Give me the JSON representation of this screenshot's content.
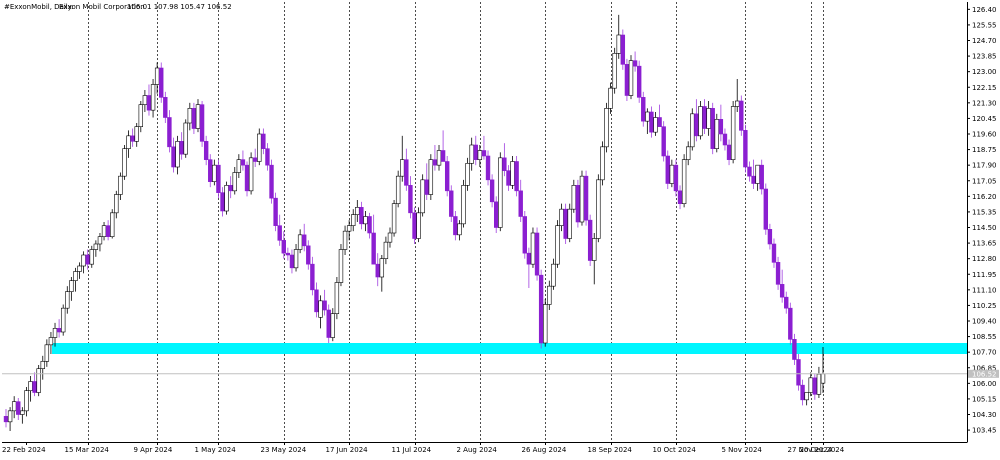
{
  "header": {
    "symbol": "#ExxonMobil, Daily:",
    "name": "Exxon Mobil Corporation",
    "ohlc": "106.01 107.98 105.47 106.52"
  },
  "colors": {
    "bull": "#ffffff",
    "bear": "#8b1fd1",
    "bear_wick": "#a040e0",
    "outline": "#000000",
    "zone": "#00f6ff",
    "grid": "#000000",
    "price_line": "#c0c0c0"
  },
  "chart_data": {
    "type": "candlestick",
    "title": "#ExxonMobil, Daily:",
    "ylim": [
      102.8,
      126.8
    ],
    "y_ticks": [
      "126.40",
      "125.55",
      "124.70",
      "123.85",
      "123.00",
      "122.15",
      "121.30",
      "120.45",
      "119.60",
      "118.75",
      "117.90",
      "117.05",
      "116.20",
      "115.35",
      "114.50",
      "113.65",
      "112.80",
      "111.95",
      "111.10",
      "110.25",
      "109.40",
      "108.55",
      "107.70",
      "106.85",
      "106.00",
      "105.15",
      "104.30",
      "103.45"
    ],
    "x_labels": [
      "22 Feb 2024",
      "15 Mar 2024",
      "9 Apr 2024",
      "1 May 2024",
      "23 May 2024",
      "17 Jun 2024",
      "11 Jul 2024",
      "2 Aug 2024",
      "26 Aug 2024",
      "18 Sep 2024",
      "10 Oct 2024",
      "5 Nov 2024",
      "27 Nov 2024",
      "20 Dec 2024"
    ],
    "current_price": "106.52",
    "support_zone": {
      "low": 107.6,
      "high": 108.2
    },
    "candles": [
      [
        104.2,
        104.6,
        103.6,
        103.9
      ],
      [
        103.9,
        104.7,
        103.4,
        104.5
      ],
      [
        104.5,
        105.3,
        104.1,
        105.0
      ],
      [
        105.0,
        105.2,
        104.0,
        104.3
      ],
      [
        104.3,
        104.7,
        103.8,
        104.5
      ],
      [
        104.5,
        105.8,
        104.2,
        105.6
      ],
      [
        105.6,
        106.4,
        105.0,
        106.1
      ],
      [
        106.1,
        106.6,
        105.3,
        105.5
      ],
      [
        105.5,
        107.0,
        105.3,
        106.8
      ],
      [
        106.8,
        107.5,
        106.2,
        107.2
      ],
      [
        107.2,
        108.4,
        106.9,
        108.1
      ],
      [
        108.1,
        108.8,
        107.6,
        108.5
      ],
      [
        108.5,
        109.3,
        108.0,
        109.0
      ],
      [
        109.0,
        109.5,
        108.5,
        108.8
      ],
      [
        108.8,
        110.3,
        108.6,
        110.1
      ],
      [
        110.1,
        111.3,
        109.8,
        111.0
      ],
      [
        111.0,
        111.8,
        110.5,
        111.6
      ],
      [
        111.6,
        112.3,
        111.0,
        112.1
      ],
      [
        112.1,
        112.6,
        111.7,
        112.4
      ],
      [
        112.4,
        113.2,
        112.0,
        113.0
      ],
      [
        113.0,
        113.3,
        112.2,
        112.5
      ],
      [
        112.5,
        113.5,
        112.3,
        113.3
      ],
      [
        113.3,
        113.8,
        112.9,
        113.6
      ],
      [
        113.6,
        114.2,
        113.2,
        114.0
      ],
      [
        114.0,
        114.8,
        113.8,
        114.6
      ],
      [
        114.6,
        114.9,
        113.8,
        114.0
      ],
      [
        114.0,
        115.5,
        113.9,
        115.3
      ],
      [
        115.3,
        116.5,
        115.0,
        116.3
      ],
      [
        116.3,
        117.5,
        116.0,
        117.3
      ],
      [
        117.3,
        119.0,
        117.1,
        118.8
      ],
      [
        118.8,
        119.8,
        118.3,
        119.5
      ],
      [
        119.5,
        119.9,
        118.9,
        119.2
      ],
      [
        119.2,
        120.2,
        118.9,
        120.0
      ],
      [
        120.0,
        121.4,
        119.7,
        121.2
      ],
      [
        121.2,
        122.0,
        120.8,
        121.7
      ],
      [
        121.7,
        122.3,
        120.6,
        120.9
      ],
      [
        120.9,
        122.6,
        120.5,
        122.3
      ],
      [
        122.3,
        123.5,
        121.8,
        123.2
      ],
      [
        123.2,
        123.5,
        121.3,
        121.6
      ],
      [
        121.6,
        121.9,
        120.2,
        120.5
      ],
      [
        120.5,
        120.9,
        118.6,
        118.9
      ],
      [
        118.9,
        119.4,
        117.5,
        117.8
      ],
      [
        117.8,
        119.5,
        117.4,
        119.2
      ],
      [
        119.2,
        119.7,
        118.2,
        118.5
      ],
      [
        118.5,
        120.4,
        118.3,
        120.2
      ],
      [
        120.2,
        121.3,
        119.8,
        121.0
      ],
      [
        121.0,
        121.3,
        119.6,
        119.9
      ],
      [
        119.9,
        121.5,
        119.7,
        121.2
      ],
      [
        121.2,
        121.4,
        118.9,
        119.2
      ],
      [
        119.2,
        119.5,
        117.9,
        118.2
      ],
      [
        118.2,
        118.5,
        116.7,
        117.0
      ],
      [
        117.0,
        118.2,
        116.8,
        117.9
      ],
      [
        117.9,
        118.2,
        116.1,
        116.4
      ],
      [
        116.4,
        116.7,
        115.1,
        115.4
      ],
      [
        115.4,
        117.0,
        115.2,
        116.8
      ],
      [
        116.8,
        117.3,
        116.1,
        116.5
      ],
      [
        116.5,
        117.8,
        116.3,
        117.5
      ],
      [
        117.5,
        118.5,
        117.2,
        118.2
      ],
      [
        118.2,
        118.7,
        117.6,
        117.9
      ],
      [
        117.9,
        118.1,
        116.2,
        116.5
      ],
      [
        116.5,
        118.6,
        116.3,
        118.3
      ],
      [
        118.3,
        118.8,
        117.8,
        118.1
      ],
      [
        118.1,
        119.9,
        117.9,
        119.6
      ],
      [
        119.6,
        119.9,
        118.5,
        118.8
      ],
      [
        118.8,
        119.1,
        117.6,
        117.9
      ],
      [
        117.9,
        118.2,
        115.8,
        116.1
      ],
      [
        116.1,
        116.4,
        114.3,
        114.6
      ],
      [
        114.6,
        115.2,
        113.5,
        113.8
      ],
      [
        113.8,
        114.3,
        112.8,
        113.1
      ],
      [
        113.1,
        113.4,
        112.7,
        113.0
      ],
      [
        113.0,
        113.3,
        112.0,
        112.3
      ],
      [
        112.3,
        113.6,
        112.1,
        113.3
      ],
      [
        113.3,
        114.4,
        113.1,
        114.1
      ],
      [
        114.1,
        114.7,
        113.2,
        113.5
      ],
      [
        113.5,
        113.8,
        112.2,
        112.5
      ],
      [
        112.5,
        112.9,
        110.8,
        111.1
      ],
      [
        111.1,
        111.5,
        109.6,
        109.9
      ],
      [
        109.6,
        110.8,
        109.0,
        110.5
      ],
      [
        110.5,
        111.1,
        109.7,
        110.0
      ],
      [
        110.0,
        110.3,
        108.2,
        108.5
      ],
      [
        108.5,
        110.1,
        108.3,
        109.8
      ],
      [
        109.8,
        111.8,
        109.5,
        111.5
      ],
      [
        111.5,
        113.6,
        111.3,
        113.3
      ],
      [
        113.3,
        114.6,
        113.0,
        114.3
      ],
      [
        114.3,
        114.9,
        113.8,
        114.6
      ],
      [
        114.6,
        115.5,
        114.3,
        115.2
      ],
      [
        115.2,
        116.0,
        114.8,
        115.6
      ],
      [
        115.6,
        115.9,
        114.4,
        114.7
      ],
      [
        114.7,
        115.4,
        114.3,
        115.1
      ],
      [
        115.1,
        115.3,
        113.9,
        114.2
      ],
      [
        114.2,
        115.2,
        112.8,
        112.5
      ],
      [
        112.5,
        113.1,
        111.3,
        111.8
      ],
      [
        111.8,
        113.0,
        111.0,
        112.8
      ],
      [
        112.8,
        114.0,
        112.5,
        113.7
      ],
      [
        113.7,
        114.5,
        113.4,
        114.2
      ],
      [
        114.2,
        116.0,
        114.0,
        115.8
      ],
      [
        115.8,
        117.6,
        115.6,
        117.3
      ],
      [
        117.3,
        119.5,
        117.0,
        118.2
      ],
      [
        118.2,
        118.8,
        116.5,
        116.8
      ],
      [
        116.8,
        117.3,
        115.0,
        115.3
      ],
      [
        115.3,
        115.6,
        113.6,
        113.9
      ],
      [
        113.9,
        115.6,
        113.7,
        115.3
      ],
      [
        115.3,
        117.4,
        115.1,
        117.1
      ],
      [
        117.1,
        118.0,
        116.0,
        116.3
      ],
      [
        116.3,
        118.5,
        116.0,
        118.2
      ],
      [
        118.2,
        119.0,
        117.6,
        117.9
      ],
      [
        117.9,
        119.0,
        117.6,
        118.7
      ],
      [
        118.7,
        119.8,
        118.4,
        118.1
      ],
      [
        118.1,
        118.4,
        116.2,
        116.5
      ],
      [
        116.5,
        116.8,
        114.8,
        115.1
      ],
      [
        115.1,
        115.4,
        113.8,
        114.1
      ],
      [
        114.1,
        114.9,
        113.8,
        114.7
      ],
      [
        114.7,
        117.1,
        114.5,
        116.8
      ],
      [
        116.8,
        118.3,
        116.5,
        118.0
      ],
      [
        118.0,
        119.4,
        117.6,
        119.0
      ],
      [
        119.0,
        119.5,
        117.9,
        118.2
      ],
      [
        118.2,
        119.0,
        117.8,
        118.7
      ],
      [
        118.7,
        119.5,
        118.2,
        118.4
      ],
      [
        118.4,
        118.7,
        116.8,
        117.1
      ],
      [
        117.1,
        117.4,
        115.6,
        115.9
      ],
      [
        115.9,
        116.2,
        114.2,
        114.5
      ],
      [
        114.5,
        118.6,
        114.3,
        118.3
      ],
      [
        118.3,
        119.1,
        117.3,
        117.6
      ],
      [
        117.6,
        117.9,
        116.5,
        116.8
      ],
      [
        116.8,
        118.4,
        116.6,
        118.1
      ],
      [
        118.1,
        118.4,
        116.2,
        116.5
      ],
      [
        116.5,
        117.1,
        114.8,
        115.1
      ],
      [
        115.1,
        115.4,
        112.8,
        113.1
      ],
      [
        113.1,
        113.4,
        111.2,
        112.5
      ],
      [
        112.5,
        114.5,
        112.3,
        114.2
      ],
      [
        114.2,
        114.5,
        111.6,
        111.9
      ],
      [
        111.9,
        112.2,
        107.9,
        108.2
      ],
      [
        108.2,
        110.6,
        108.0,
        110.3
      ],
      [
        110.3,
        111.6,
        110.0,
        111.3
      ],
      [
        111.3,
        112.8,
        111.1,
        112.5
      ],
      [
        112.5,
        114.9,
        112.3,
        114.6
      ],
      [
        114.6,
        115.8,
        114.3,
        115.5
      ],
      [
        115.5,
        115.8,
        113.6,
        113.9
      ],
      [
        113.9,
        115.8,
        113.7,
        115.5
      ],
      [
        115.5,
        117.1,
        115.3,
        116.8
      ],
      [
        116.8,
        117.1,
        114.5,
        114.8
      ],
      [
        114.8,
        117.6,
        114.6,
        117.3
      ],
      [
        117.3,
        117.6,
        114.6,
        114.9
      ],
      [
        114.9,
        115.2,
        112.4,
        112.7
      ],
      [
        112.7,
        114.2,
        111.4,
        113.9
      ],
      [
        113.9,
        117.4,
        113.7,
        117.1
      ],
      [
        117.1,
        119.2,
        116.8,
        118.9
      ],
      [
        118.9,
        121.3,
        118.6,
        121.0
      ],
      [
        121.0,
        122.4,
        120.7,
        122.1
      ],
      [
        122.1,
        124.3,
        121.8,
        124.0
      ],
      [
        124.0,
        126.1,
        123.7,
        125.0
      ],
      [
        125.0,
        125.3,
        123.1,
        123.4
      ],
      [
        123.4,
        123.7,
        121.4,
        121.7
      ],
      [
        121.7,
        123.9,
        121.5,
        123.6
      ],
      [
        123.6,
        124.1,
        123.0,
        123.3
      ],
      [
        123.3,
        123.6,
        121.3,
        121.6
      ],
      [
        121.6,
        121.9,
        120.0,
        120.3
      ],
      [
        120.3,
        121.0,
        119.6,
        120.8
      ],
      [
        120.8,
        121.1,
        119.4,
        119.7
      ],
      [
        119.7,
        120.8,
        119.5,
        120.5
      ],
      [
        120.5,
        121.2,
        120.2,
        120.0
      ],
      [
        120.0,
        120.3,
        118.1,
        118.4
      ],
      [
        118.4,
        118.7,
        116.6,
        116.9
      ],
      [
        116.9,
        118.2,
        116.7,
        117.9
      ],
      [
        117.9,
        118.2,
        116.2,
        116.5
      ],
      [
        116.5,
        116.8,
        115.5,
        115.8
      ],
      [
        115.8,
        118.5,
        115.6,
        118.2
      ],
      [
        118.2,
        119.2,
        117.9,
        118.9
      ],
      [
        118.9,
        121.0,
        118.7,
        120.7
      ],
      [
        120.7,
        121.5,
        119.2,
        119.5
      ],
      [
        119.5,
        121.4,
        119.3,
        121.1
      ],
      [
        121.1,
        121.5,
        119.6,
        119.9
      ],
      [
        119.9,
        121.4,
        119.5,
        121.0
      ],
      [
        121.0,
        121.3,
        118.5,
        118.8
      ],
      [
        118.8,
        120.7,
        118.6,
        120.4
      ],
      [
        120.4,
        121.2,
        119.2,
        119.6
      ],
      [
        119.6,
        119.9,
        118.7,
        119.0
      ],
      [
        119.0,
        119.3,
        117.9,
        118.2
      ],
      [
        118.2,
        121.4,
        118.0,
        121.1
      ],
      [
        121.1,
        122.6,
        120.8,
        121.4
      ],
      [
        121.4,
        121.7,
        119.5,
        119.8
      ],
      [
        119.8,
        120.1,
        117.5,
        117.8
      ],
      [
        117.8,
        118.1,
        117.0,
        117.3
      ],
      [
        117.3,
        118.2,
        116.6,
        116.9
      ],
      [
        116.9,
        117.2,
        116.5,
        117.9
      ],
      [
        117.9,
        118.2,
        116.3,
        116.6
      ],
      [
        116.6,
        116.9,
        114.1,
        114.4
      ],
      [
        114.4,
        114.7,
        113.3,
        113.6
      ],
      [
        113.6,
        113.9,
        112.3,
        112.6
      ],
      [
        112.6,
        112.9,
        111.1,
        111.4
      ],
      [
        111.4,
        112.2,
        110.4,
        110.7
      ],
      [
        110.7,
        111.0,
        109.8,
        110.1
      ],
      [
        110.1,
        110.4,
        108.1,
        108.4
      ],
      [
        108.4,
        108.7,
        107.0,
        107.3
      ],
      [
        107.3,
        107.6,
        105.6,
        105.9
      ],
      [
        105.9,
        106.2,
        104.8,
        105.1
      ],
      [
        105.1,
        105.4,
        104.8,
        105.5
      ],
      [
        105.5,
        106.6,
        105.3,
        106.3
      ],
      [
        106.3,
        106.5,
        105.1,
        105.4
      ],
      [
        105.4,
        106.9,
        105.2,
        106.5
      ],
      [
        106.01,
        107.98,
        105.47,
        106.52
      ]
    ]
  }
}
